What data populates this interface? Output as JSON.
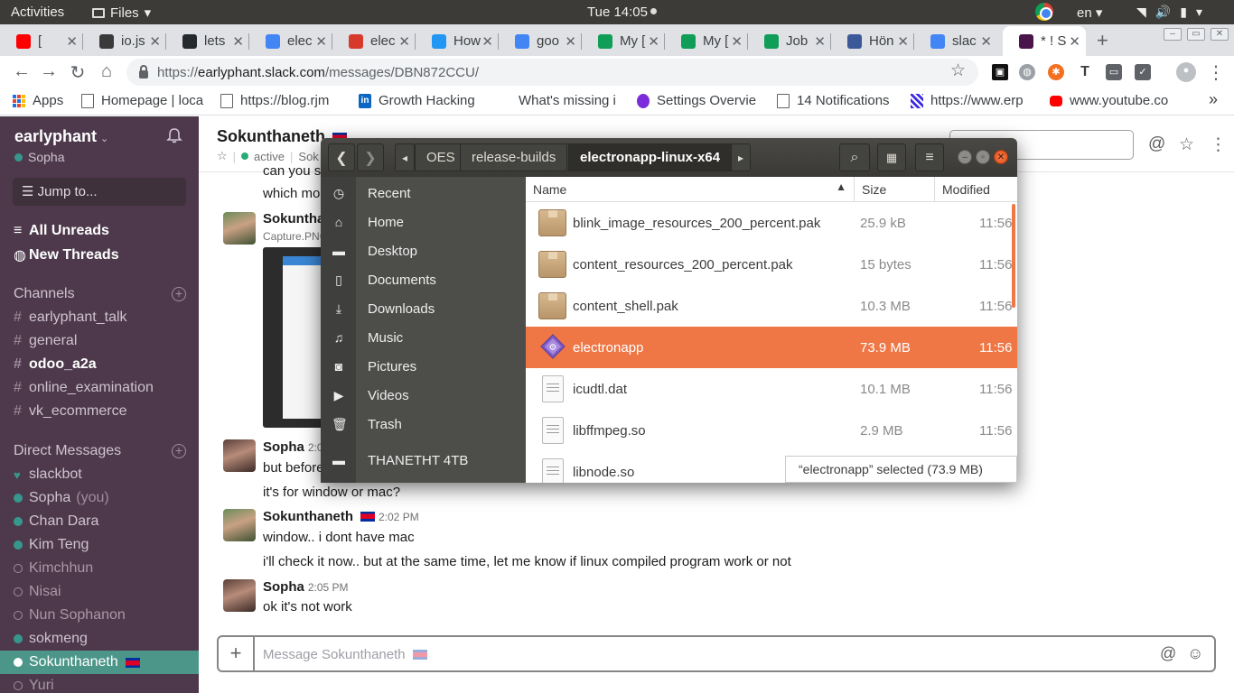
{
  "topbar": {
    "activities": "Activities",
    "app": "Files",
    "clock": "Tue 14:05",
    "lang": "en"
  },
  "tabs": [
    {
      "title": "[",
      "color": "#ff0000"
    },
    {
      "title": "io.js",
      "color": "#3a3a3a"
    },
    {
      "title": "lets",
      "color": "#24292e"
    },
    {
      "title": "elec",
      "color": "#4285f4"
    },
    {
      "title": "elec",
      "color": "#d73a2b"
    },
    {
      "title": "How",
      "color": "#2196f3"
    },
    {
      "title": "goo",
      "color": "#4285f4"
    },
    {
      "title": "My [",
      "color": "#0f9d58"
    },
    {
      "title": "My [",
      "color": "#0f9d58"
    },
    {
      "title": "Job",
      "color": "#0f9d58"
    },
    {
      "title": "Hön",
      "color": "#3b5998"
    },
    {
      "title": "slac",
      "color": "#4285f4"
    },
    {
      "title": "* ! S",
      "color": "#4a154b"
    }
  ],
  "address": {
    "scheme": "https://",
    "host": "earlyphant.slack.com",
    "path": "/messages/DBN872CCU/"
  },
  "bookmarks": [
    {
      "label": "Apps"
    },
    {
      "label": "Homepage | loca"
    },
    {
      "label": "https://blog.rjm"
    },
    {
      "label": "Growth Hacking"
    },
    {
      "label": "What's missing i"
    },
    {
      "label": "Settings Overvie"
    },
    {
      "label": "14 Notifications"
    },
    {
      "label": "https://www.erp"
    },
    {
      "label": "www.youtube.co"
    }
  ],
  "slack": {
    "workspace": "earlyphant",
    "user": "Sopha",
    "jump": "Jump to...",
    "all_unreads": "All Unreads",
    "new_threads": "New Threads",
    "channels_head": "Channels",
    "channels": [
      "earlyphant_talk",
      "general",
      "odoo_a2a",
      "online_examination",
      "vk_ecommerce"
    ],
    "dm_head": "Direct Messages",
    "dms": [
      {
        "name": "slackbot"
      },
      {
        "name": "Sopha",
        "suffix": "(you)"
      },
      {
        "name": "Chan Dara"
      },
      {
        "name": "Kim Teng"
      },
      {
        "name": "Kimchhun"
      },
      {
        "name": "Nisai"
      },
      {
        "name": "Nun Sophanon"
      },
      {
        "name": "sokmeng"
      },
      {
        "name": "Sokunthaneth"
      },
      {
        "name": "Yuri"
      }
    ],
    "channel_title": "Sokunthaneth",
    "status": "active",
    "sub_more": "Sok",
    "messages": {
      "m0": "can you s",
      "m1": "which mo",
      "m2_name": "Sokuntha",
      "m2_file": "Capture.PNG",
      "m3_name": "Sopha",
      "m3_time": "2:0",
      "m3_text": "but before",
      "m3_text2": "it's for window or mac?",
      "m4_name": "Sokunthaneth",
      "m4_time": "2:02 PM",
      "m4_text": "window.. i dont have mac",
      "m4_text2": "i'll check it now.. but at the same time, let me know if linux compiled program work or not",
      "m5_name": "Sopha",
      "m5_time": "2:05 PM",
      "m5_text": "ok it's not work"
    },
    "composer_placeholder": "Message Sokunthaneth"
  },
  "nautilus": {
    "breadcrumbs": [
      "OES",
      "release-builds",
      "electronapp-linux-x64"
    ],
    "places": [
      "Recent",
      "Home",
      "Desktop",
      "Documents",
      "Downloads",
      "Music",
      "Pictures",
      "Videos",
      "Trash",
      "THANETHT 4TB"
    ],
    "columns": {
      "name": "Name",
      "size": "Size",
      "modified": "Modified"
    },
    "files": [
      {
        "name": "blink_image_resources_200_percent.pak",
        "size": "25.9 kB",
        "modified": "11:56",
        "icon": "package-icon"
      },
      {
        "name": "content_resources_200_percent.pak",
        "size": "15 bytes",
        "modified": "11:56",
        "icon": "package-icon"
      },
      {
        "name": "content_shell.pak",
        "size": "10.3 MB",
        "modified": "11:56",
        "icon": "package-icon"
      },
      {
        "name": "electronapp",
        "size": "73.9 MB",
        "modified": "11:56",
        "icon": "executable-icon",
        "selected": true
      },
      {
        "name": "icudtl.dat",
        "size": "10.1 MB",
        "modified": "11:56",
        "icon": "binary-file-icon"
      },
      {
        "name": "libffmpeg.so",
        "size": "2.9 MB",
        "modified": "11:56",
        "icon": "library-file-icon"
      },
      {
        "name": "libnode.so",
        "size": "",
        "modified": "",
        "icon": "library-file-icon"
      }
    ],
    "status": "“electronapp” selected  (73.9 MB)"
  },
  "colors": {
    "slack_sidebar": "#4d394b",
    "slack_selected": "#4c9689",
    "nautilus_accent": "#ef7746"
  }
}
